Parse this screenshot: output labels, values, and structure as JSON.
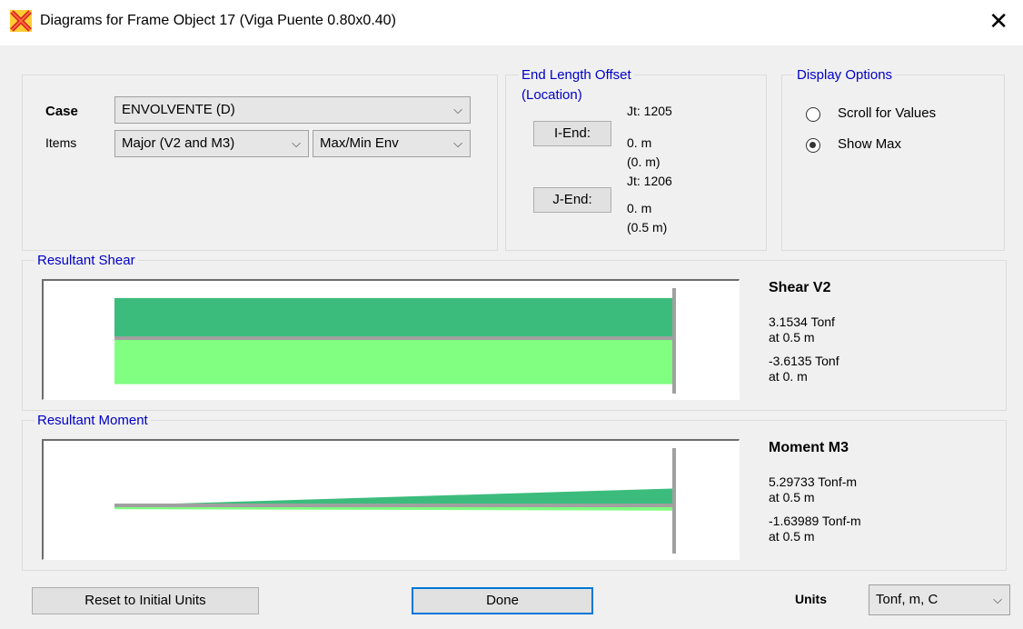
{
  "window": {
    "title": "Diagrams for Frame Object 17  (Viga Puente 0.80x0.40)",
    "close": "✕"
  },
  "case": {
    "label": "Case",
    "value": "ENVOLVENTE (D)"
  },
  "items": {
    "label": "Items",
    "component": "Major (V2 and M3)",
    "envelope": "Max/Min Env"
  },
  "end_offset": {
    "title_line1": "End Length Offset",
    "title_line2": "(Location)",
    "i_end": {
      "button": "I-End:",
      "jt": "Jt:  1205",
      "offset": "0. m",
      "location": "(0. m)"
    },
    "j_end": {
      "button": "J-End:",
      "jt": "Jt:  1206",
      "offset": "0. m",
      "location": "(0.5 m)"
    }
  },
  "display_options": {
    "title": "Display Options",
    "options": [
      {
        "label": "Scroll for Values",
        "selected": false
      },
      {
        "label": "Show Max",
        "selected": true
      }
    ]
  },
  "shear": {
    "group_title": "Resultant Shear",
    "heading": "Shear V2",
    "max_value": "3.1534 Tonf",
    "max_loc": "at 0.5 m",
    "min_value": "-3.6135 Tonf",
    "min_loc": "at 0. m",
    "diagram": {
      "max_start": 3.1534,
      "max_end": 3.1534,
      "min_start": -3.6135,
      "min_end": -3.6135
    }
  },
  "moment": {
    "group_title": "Resultant Moment",
    "heading": "Moment M3",
    "max_value": "5.29733 Tonf-m",
    "max_loc": "at 0.5 m",
    "min_value": "-1.63989 Tonf-m",
    "min_loc": "at 0.5 m",
    "diagram": {
      "max_start": 0,
      "max_end": 5.29733,
      "min_start": -1.2,
      "min_end": -1.63989
    }
  },
  "colors": {
    "max_fill": "#3cbc7c",
    "min_fill": "#80ff80",
    "axis": "#a0a0a0",
    "group_title": "#0000c8"
  },
  "footer": {
    "reset": "Reset to Initial Units",
    "done": "Done",
    "units_label": "Units",
    "units_value": "Tonf, m, C"
  }
}
